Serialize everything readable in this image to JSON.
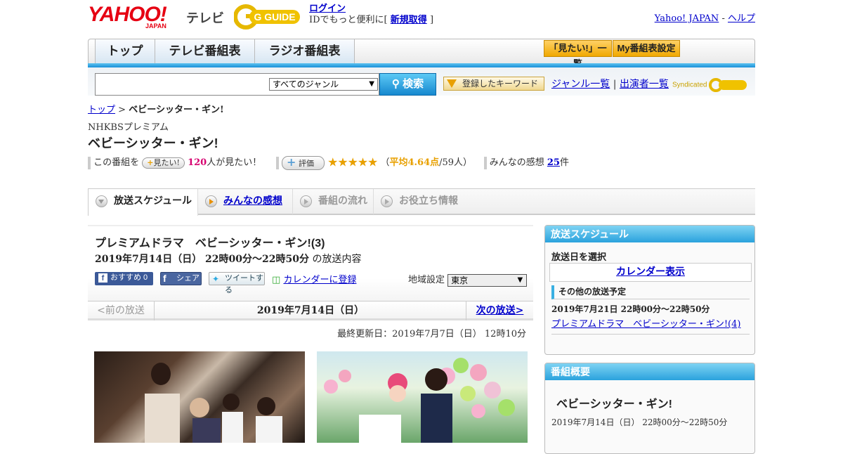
{
  "header": {
    "logo_text": "YAHOO!",
    "logo_sub": "JAPAN",
    "logo_tv": "テレビ",
    "gguide": "G GUIDE",
    "login": "ログイン",
    "login_note": "IDでもっと便利に[",
    "signup": "新規取得",
    "login_close": "]",
    "yahoo_japan": "Yahoo! JAPAN",
    "sep": "-",
    "help": "ヘルプ"
  },
  "nav": {
    "tabs": [
      "トップ",
      "テレビ番組表",
      "ラジオ番組表"
    ],
    "mitai_list": "「見たい!」一覧",
    "my_settings": "My番組表設定"
  },
  "search": {
    "genre": "すべてのジャンル",
    "button": "検索",
    "keywords": "登録したキーワード",
    "genre_list": "ジャンル一覧",
    "divider": "|",
    "performers": "出演者一覧",
    "syndicated": "Syndicated"
  },
  "breadcrumb": {
    "top": "トップ",
    "sep": ">",
    "current": "ベビーシッター・ギン!"
  },
  "program": {
    "channel": "NHKBSプレミアム",
    "title": "ベビーシッター・ギン!",
    "want_prefix": "この番組を",
    "want_btn": "見たい!",
    "want_count": "120",
    "want_suffix": "人が見たい！",
    "rating_label": "評価",
    "stars": "★★★★★",
    "rating_avg": "平均4.64点",
    "rating_people": "/59人）",
    "rating_open": "（",
    "comments_label": "みんなの感想",
    "comments_count": "25",
    "comments_unit": "件"
  },
  "content_tabs": [
    "放送スケジュール",
    "みんなの感想",
    "番組の流れ",
    "お役立ち情報"
  ],
  "episode": {
    "name": "プレミアムドラマ　ベビーシッター・ギン!(3)",
    "datetime": "2019年7月14日（日）  22時00分～22時50分",
    "suffix": "の放送内容",
    "recommend": "おすすめ 0",
    "share": "シェア",
    "tweet": "ツイートする",
    "calendar": "カレンダーに登録",
    "region_label": "地域設定",
    "region": "東京",
    "prev": "<前の放送",
    "current_date": "2019年7月14日（日）",
    "next": "次の放送>",
    "updated": "最終更新日：2019年7月7日（日）  12時10分"
  },
  "schedule_panel": {
    "title": "放送スケジュール",
    "select_date": "放送日を選択",
    "calendar": "カレンダー表示",
    "other": "その他の放送予定",
    "other_datetime": "2019年7月21日  22時00分～22時50分",
    "other_title": "プレミアムドラマ　ベビーシッター・ギン!(4)"
  },
  "summary_panel": {
    "title": "番組概要",
    "name": "ベビーシッター・ギン!",
    "datetime": "2019年7月14日（日）  22時00分～22時50分"
  }
}
